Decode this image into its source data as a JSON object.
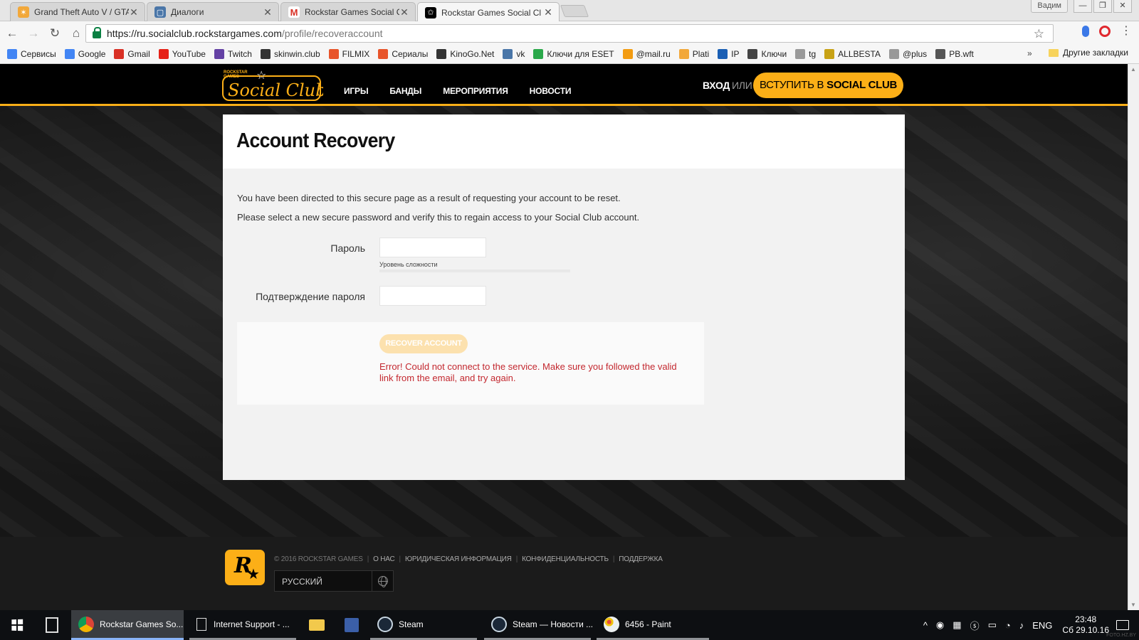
{
  "browser": {
    "tabs": [
      {
        "title": "Grand Theft Auto V / GTA",
        "icon": "gta-icon",
        "color": "#f2a83a"
      },
      {
        "title": "Диалоги",
        "icon": "vk-dialogs-icon",
        "color": "#4a76a8"
      },
      {
        "title": "Rockstar Games Social Cl",
        "icon": "gmail-icon",
        "color": "#d93025"
      },
      {
        "title": "Rockstar Games Social Cl",
        "icon": "social-club-icon",
        "color": "#000000"
      }
    ],
    "active_tab": 3,
    "user_name": "Вадим",
    "url_host": "https://ru.socialclub.rockstargames.com",
    "url_path": "/profile/recoveraccount",
    "bookmarks": [
      {
        "label": "Сервисы",
        "color": "#4285f4"
      },
      {
        "label": "Google",
        "color": "#4285f4"
      },
      {
        "label": "Gmail",
        "color": "#d93025"
      },
      {
        "label": "YouTube",
        "color": "#e62117"
      },
      {
        "label": "Twitch",
        "color": "#6441a4"
      },
      {
        "label": "skinwin.club",
        "color": "#333333"
      },
      {
        "label": "FILMIX",
        "color": "#e8542a"
      },
      {
        "label": "Сериалы",
        "color": "#e8542a"
      },
      {
        "label": "KinoGo.Net",
        "color": "#333333"
      },
      {
        "label": "vk",
        "color": "#4a76a8"
      },
      {
        "label": "Ключи для ESET",
        "color": "#2aa84a"
      },
      {
        "label": "@mail.ru",
        "color": "#f39c12"
      },
      {
        "label": "Plati",
        "color": "#f2a83a"
      },
      {
        "label": "IP",
        "color": "#1a5fb4"
      },
      {
        "label": "Ключи",
        "color": "#444444"
      },
      {
        "label": "tg",
        "color": "#999999"
      },
      {
        "label": "ALLBESTA",
        "color": "#c8a215"
      },
      {
        "label": "@plus",
        "color": "#999999"
      },
      {
        "label": "PB.wft",
        "color": "#555555"
      }
    ],
    "bookmarks_more": "»",
    "other_bookmarks": "Другие закладки"
  },
  "site": {
    "nav": [
      "ИГРЫ",
      "БАНДЫ",
      "МЕРОПРИЯТИЯ",
      "НОВОСТИ"
    ],
    "login": "ВХОД",
    "or": "ИЛИ",
    "join_prefix": "ВСТУПИТЬ В",
    "join_bold": "SOCIAL CLUB",
    "brand_color": "#fcaf17"
  },
  "recovery": {
    "title": "Account Recovery",
    "intro_line1": "You have been directed to this secure page as a result of requesting your account to be reset.",
    "intro_line2": "Please select a new secure password and verify this to regain access to your Social Club account.",
    "password_label": "Пароль",
    "password_value": "",
    "strength_label": "Уровень сложности",
    "strength_level": 0,
    "confirm_label": "Подтверждение пароля",
    "confirm_value": "",
    "button_label": "RECOVER ACCOUNT",
    "error": "Error! Could not connect to the service. Make sure you followed the valid link from the email, and try again.",
    "error_color": "#c3282f"
  },
  "footer": {
    "copyright": "© 2016 ROCKSTAR GAMES",
    "links": [
      "О НАС",
      "ЮРИДИЧЕСКАЯ ИНФОРМАЦИЯ",
      "КОНФИДЕНЦИАЛЬНОСТЬ",
      "ПОДДЕРЖКА"
    ],
    "language": "РУССКИЙ"
  },
  "taskbar": {
    "items": [
      {
        "label": "Rockstar Games So...",
        "icon": "chrome-icon"
      },
      {
        "label": "Internet Support - ...",
        "icon": "document-icon"
      },
      {
        "label": "",
        "icon": "file-explorer-icon"
      },
      {
        "label": "",
        "icon": "save-icon"
      },
      {
        "label": "Steam",
        "icon": "steam-icon"
      },
      {
        "label": "Steam — Новости ...",
        "icon": "steam-icon"
      },
      {
        "label": "6456 - Paint",
        "icon": "paint-icon"
      }
    ],
    "lang": "ENG",
    "time": "23:48",
    "date": "Сб 29.10.16"
  },
  "watermark": "FOTO.HZ.BY"
}
